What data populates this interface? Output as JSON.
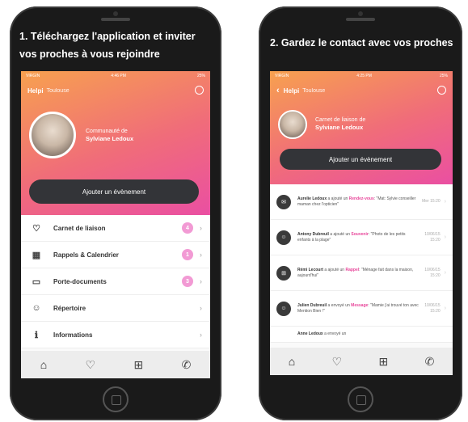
{
  "captions": {
    "left_line1": "1. Téléchargez l'application et inviter",
    "left_line2": "vos proches à vous rejoindre",
    "right": "2. Gardez le contact avec vos proches"
  },
  "status_bar": {
    "carrier": "VIRGIN",
    "time_left": "4:46 PM",
    "time_right": "4:25 PM",
    "battery": "25%"
  },
  "app": {
    "brand": "Helpi",
    "city": "Toulouse"
  },
  "community": {
    "title": "Communauté de",
    "owner_left": "Sylviane Ledoux",
    "title_right": "Carnet de liaison de",
    "owner_right": "Sylviane Ledoux"
  },
  "cta_label": "Ajouter un évènement",
  "menu": [
    {
      "icon": "heart-icon",
      "label": "Carnet de liaison",
      "badge": "4"
    },
    {
      "icon": "calendar-icon",
      "label": "Rappels & Calendrier",
      "badge": "1"
    },
    {
      "icon": "folder-icon",
      "label": "Porte-documents",
      "badge": "3"
    },
    {
      "icon": "contacts-icon",
      "label": "Répertoire",
      "badge": ""
    },
    {
      "icon": "info-icon",
      "label": "Informations",
      "badge": ""
    }
  ],
  "feed": [
    {
      "icon": "message-icon",
      "author": "Aurelie Ledoux",
      "action": "a ajouté un",
      "category": "Rendez-vous",
      "text": ": \"Mat: Sylvie conseiller maman chez l'opticien\"",
      "date": "Mer 15:20"
    },
    {
      "icon": "user-icon",
      "author": "Antony Dubreuil",
      "action": "a ajouté un",
      "category": "Souvenir",
      "text": ": \"Photo de les petits enfants à la plage\"",
      "date": "10/06/15 15:20"
    },
    {
      "icon": "gift-icon",
      "author": "Rémi Lecourt",
      "action": "a ajouté un",
      "category": "Rappel",
      "text": ": \"Ménage fait dans la maison, aujourd'hui\"",
      "date": "10/06/15 15:20"
    },
    {
      "icon": "user-icon",
      "author": "Julien Dubreuil",
      "action": "a envoyé un",
      "category": "Message",
      "text": ": \"Mamie j'ai trouvé ton avec Mention Bien !\"",
      "date": "10/06/15 15:20"
    },
    {
      "icon": "message-icon",
      "author": "Anne Ledoux",
      "action": "a envoyé un",
      "category": "",
      "text": "",
      "date": ""
    }
  ],
  "tabs": [
    {
      "icon": "home-icon",
      "glyph": "⌂"
    },
    {
      "icon": "heart-icon",
      "glyph": "♡"
    },
    {
      "icon": "gift-icon",
      "glyph": "⊞"
    },
    {
      "icon": "phone-icon",
      "glyph": "✆"
    }
  ]
}
